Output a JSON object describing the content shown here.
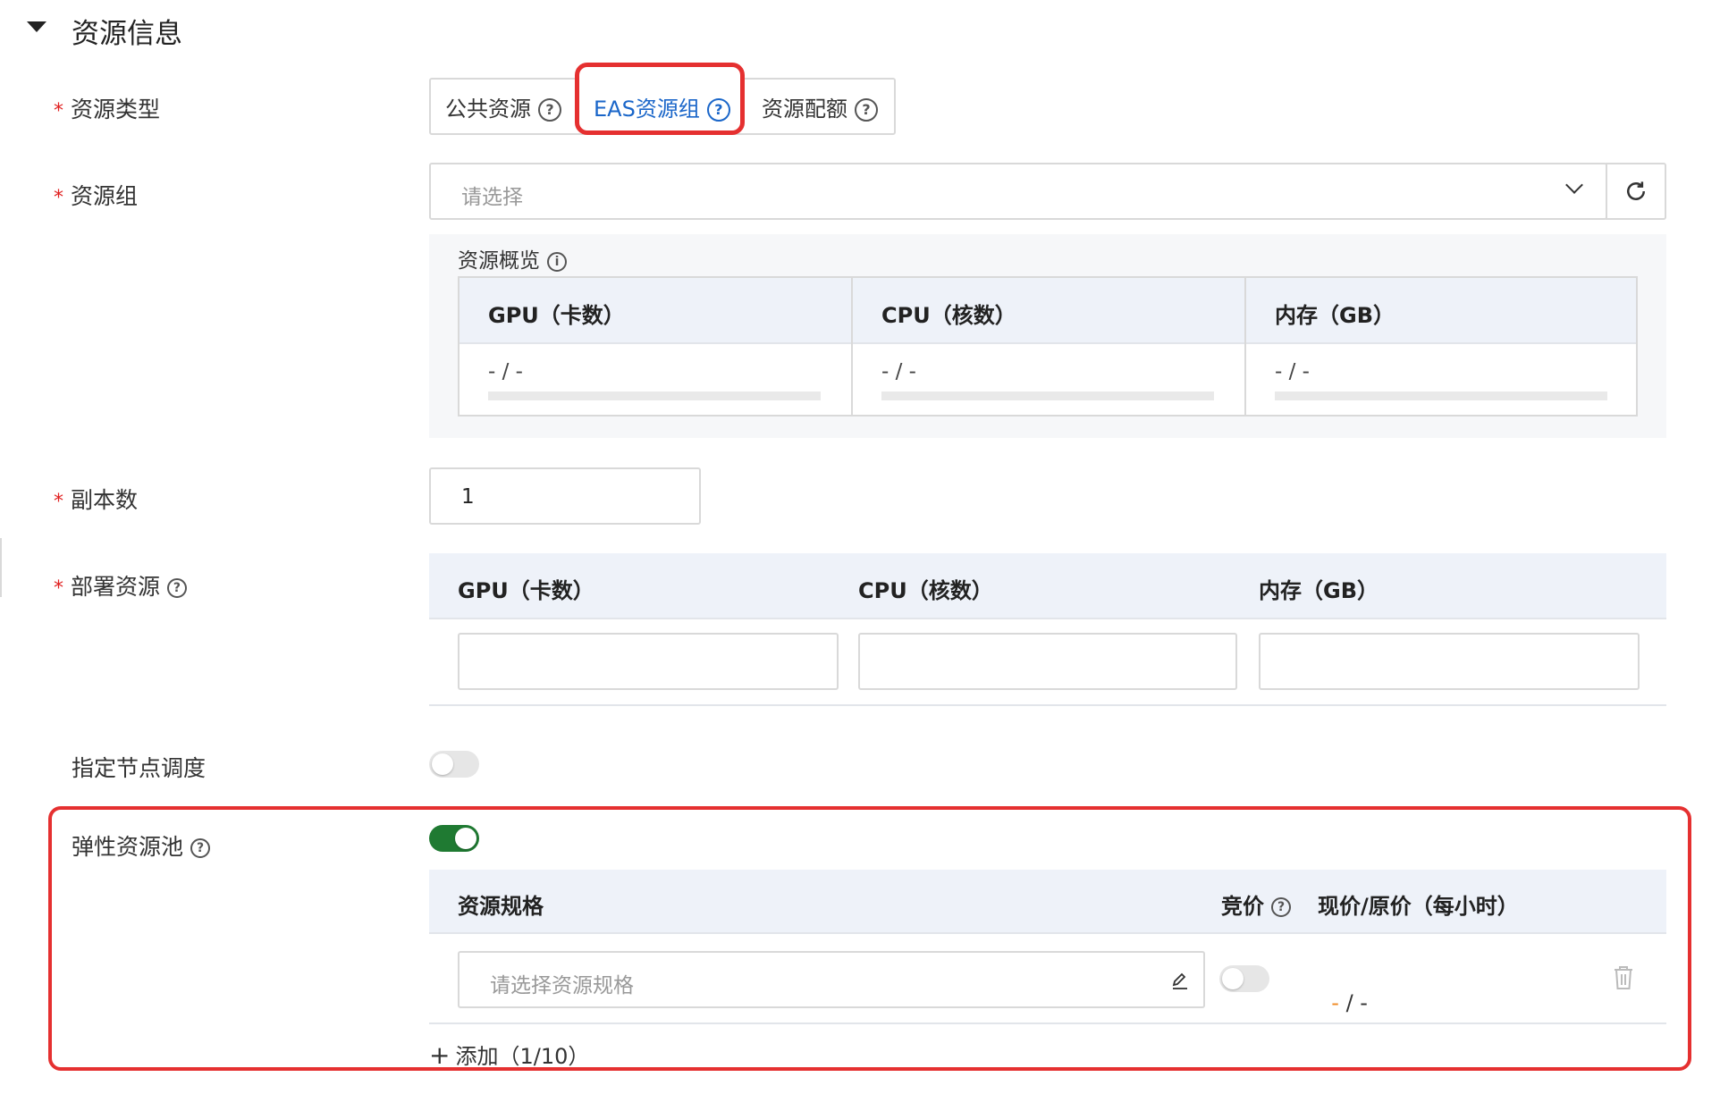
{
  "section": {
    "title": "资源信息"
  },
  "resource_type": {
    "label": "资源类型",
    "options": [
      {
        "label": "公共资源"
      },
      {
        "label": "EAS资源组",
        "selected": true
      },
      {
        "label": "资源配额"
      }
    ]
  },
  "resource_group": {
    "label": "资源组",
    "placeholder": "请选择",
    "overview": {
      "title": "资源概览",
      "columns": [
        "GPU（卡数）",
        "CPU（核数）",
        "内存（GB）"
      ],
      "values": [
        "- / -",
        "- / -",
        "- / -"
      ]
    }
  },
  "replicas": {
    "label": "副本数",
    "value": "1"
  },
  "deploy_resources": {
    "label": "部署资源",
    "columns": [
      "GPU（卡数）",
      "CPU（核数）",
      "内存（GB）"
    ]
  },
  "node_scheduling": {
    "label": "指定节点调度",
    "enabled": false
  },
  "elastic_pool": {
    "label": "弹性资源池",
    "enabled": true,
    "table": {
      "col_spec": "资源规格",
      "col_bid": "竞价",
      "col_price": "现价/原价（每小时）"
    },
    "row": {
      "spec_placeholder": "请选择资源规格",
      "bid_enabled": false,
      "price_current": "-",
      "price_separator": " / ",
      "price_original": "-"
    },
    "add_label": "添加（1/10）"
  },
  "colors": {
    "accent_blue": "#1a66c9",
    "toggle_on": "#1f7a32",
    "highlight_red": "#e53030",
    "price_orange": "#f08a24"
  }
}
